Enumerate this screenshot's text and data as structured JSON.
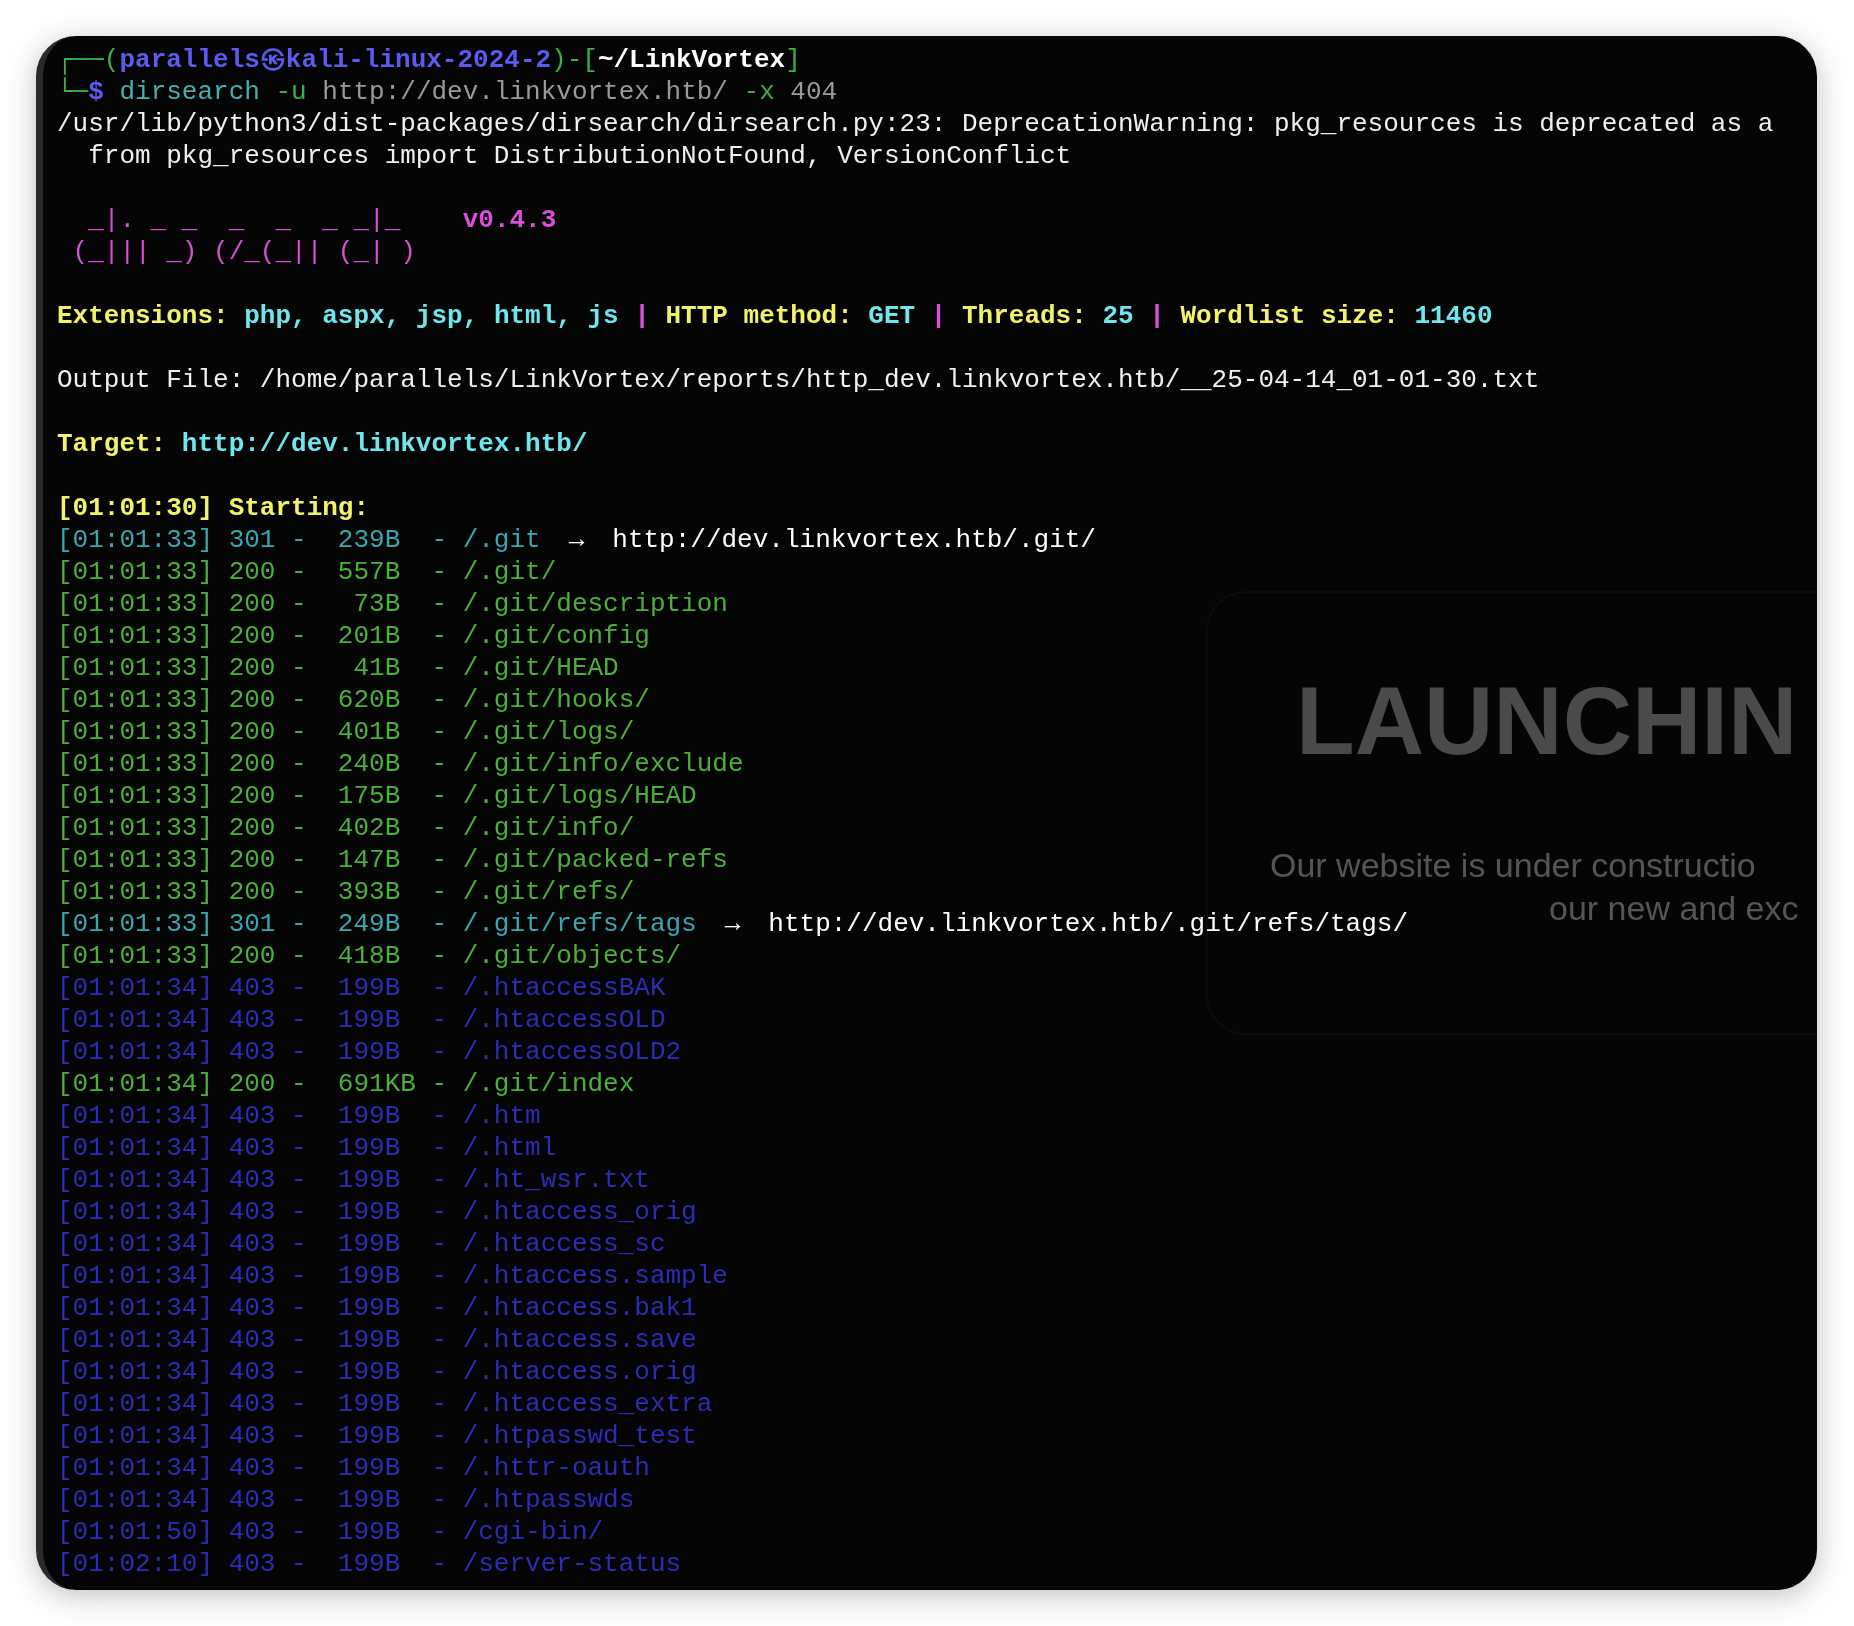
{
  "terminal": {
    "lines": [
      {
        "kind": "text",
        "segments": [
          {
            "text": "┌──(",
            "kind": "frame"
          },
          {
            "text": "parallels㉿kali-linux-2024-2",
            "kind": "userhost"
          },
          {
            "text": ")-[",
            "kind": "frame"
          },
          {
            "text": "~/LinkVortex",
            "kind": "cwd"
          },
          {
            "text": "]",
            "kind": "frame"
          }
        ]
      },
      {
        "kind": "text",
        "segments": [
          {
            "text": "└─",
            "kind": "frame"
          },
          {
            "text": "$",
            "kind": "dollar"
          },
          {
            "text": " dirsearch",
            "kind": "cmd"
          },
          {
            "text": " -u",
            "kind": "flag"
          },
          {
            "text": " http://dev.linkvortex.htb/",
            "kind": "arg"
          },
          {
            "text": " -x",
            "kind": "flag"
          },
          {
            "text": " 404",
            "kind": "arg"
          }
        ]
      },
      {
        "kind": "text",
        "segments": [
          {
            "text": "/usr/lib/python3/dist-packages/dirsearch/dirsearch.py:23: DeprecationWarning: pkg_resources is deprecated as a",
            "kind": "plain"
          }
        ]
      },
      {
        "kind": "text",
        "segments": [
          {
            "text": "  from pkg_resources import DistributionNotFound, VersionConflict",
            "kind": "plain"
          }
        ]
      },
      {
        "kind": "blank"
      },
      {
        "kind": "text",
        "segments": [
          {
            "text": "  _|. _ _  _  _  _ _|_",
            "kind": "banner"
          },
          {
            "text": "    v0.4.3",
            "kind": "version"
          }
        ]
      },
      {
        "kind": "text",
        "segments": [
          {
            "text": " (_||| _) (/_(_|| (_| )",
            "kind": "banner"
          }
        ]
      },
      {
        "kind": "blank"
      },
      {
        "kind": "text",
        "segments": [
          {
            "text": "Extensions: ",
            "kind": "label"
          },
          {
            "text": "php, aspx, jsp, html, js",
            "kind": "value"
          },
          {
            "text": " | ",
            "kind": "sep"
          },
          {
            "text": "HTTP method: ",
            "kind": "label"
          },
          {
            "text": "GET",
            "kind": "value"
          },
          {
            "text": " | ",
            "kind": "sep"
          },
          {
            "text": "Threads: ",
            "kind": "label"
          },
          {
            "text": "25",
            "kind": "value"
          },
          {
            "text": " | ",
            "kind": "sep"
          },
          {
            "text": "Wordlist size: ",
            "kind": "label"
          },
          {
            "text": "11460",
            "kind": "value"
          }
        ]
      },
      {
        "kind": "blank"
      },
      {
        "kind": "text",
        "segments": [
          {
            "text": "Output File: /home/parallels/LinkVortex/reports/http_dev.linkvortex.htb/__25-04-14_01-01-30.txt",
            "kind": "plain"
          }
        ]
      },
      {
        "kind": "blank"
      },
      {
        "kind": "text",
        "segments": [
          {
            "text": "Target: ",
            "kind": "label"
          },
          {
            "text": "http://dev.linkvortex.htb/",
            "kind": "value"
          }
        ]
      },
      {
        "kind": "blank"
      },
      {
        "kind": "text",
        "segments": [
          {
            "text": "[01:01:30] Starting:",
            "kind": "label"
          }
        ]
      },
      {
        "kind": "text",
        "segments": [
          {
            "text": "[01:01:33] 301 -  239B  - /.git",
            "kind": "redirect"
          },
          {
            "text": "→",
            "kind": "arrow"
          },
          {
            "text": "http://dev.linkvortex.htb/.git/",
            "kind": "url"
          }
        ]
      },
      {
        "kind": "text",
        "segments": [
          {
            "text": "[01:01:33] 200 -  557B  - /.git/",
            "kind": "ok"
          }
        ]
      },
      {
        "kind": "text",
        "segments": [
          {
            "text": "[01:01:33] 200 -   73B  - /.git/description",
            "kind": "ok"
          }
        ]
      },
      {
        "kind": "text",
        "segments": [
          {
            "text": "[01:01:33] 200 -  201B  - /.git/config",
            "kind": "ok"
          }
        ]
      },
      {
        "kind": "text",
        "segments": [
          {
            "text": "[01:01:33] 200 -   41B  - /.git/HEAD",
            "kind": "ok"
          }
        ]
      },
      {
        "kind": "text",
        "segments": [
          {
            "text": "[01:01:33] 200 -  620B  - /.git/hooks/",
            "kind": "ok"
          }
        ]
      },
      {
        "kind": "text",
        "segments": [
          {
            "text": "[01:01:33] 200 -  401B  - /.git/logs/",
            "kind": "ok"
          }
        ]
      },
      {
        "kind": "text",
        "segments": [
          {
            "text": "[01:01:33] 200 -  240B  - /.git/info/exclude",
            "kind": "ok"
          }
        ]
      },
      {
        "kind": "text",
        "segments": [
          {
            "text": "[01:01:33] 200 -  175B  - /.git/logs/HEAD",
            "kind": "ok"
          }
        ]
      },
      {
        "kind": "text",
        "segments": [
          {
            "text": "[01:01:33] 200 -  402B  - /.git/info/",
            "kind": "ok"
          }
        ]
      },
      {
        "kind": "text",
        "segments": [
          {
            "text": "[01:01:33] 200 -  147B  - /.git/packed-refs",
            "kind": "ok"
          }
        ]
      },
      {
        "kind": "text",
        "segments": [
          {
            "text": "[01:01:33] 200 -  393B  - /.git/refs/",
            "kind": "ok"
          }
        ]
      },
      {
        "kind": "text",
        "segments": [
          {
            "text": "[01:01:33] 301 -  249B  - /.git/refs/tags",
            "kind": "redirect"
          },
          {
            "text": "→",
            "kind": "arrow"
          },
          {
            "text": "http://dev.linkvortex.htb/.git/refs/tags/",
            "kind": "url"
          }
        ]
      },
      {
        "kind": "text",
        "segments": [
          {
            "text": "[01:01:33] 200 -  418B  - /.git/objects/",
            "kind": "ok"
          }
        ]
      },
      {
        "kind": "text",
        "segments": [
          {
            "text": "[01:01:34] 403 -  199B  - /.htaccessBAK",
            "kind": "forbidden"
          }
        ]
      },
      {
        "kind": "text",
        "segments": [
          {
            "text": "[01:01:34] 403 -  199B  - /.htaccessOLD",
            "kind": "forbidden"
          }
        ]
      },
      {
        "kind": "text",
        "segments": [
          {
            "text": "[01:01:34] 403 -  199B  - /.htaccessOLD2",
            "kind": "forbidden"
          }
        ]
      },
      {
        "kind": "text",
        "segments": [
          {
            "text": "[01:01:34] 200 -  691KB - /.git/index",
            "kind": "ok"
          }
        ]
      },
      {
        "kind": "text",
        "segments": [
          {
            "text": "[01:01:34] 403 -  199B  - /.htm",
            "kind": "forbidden"
          }
        ]
      },
      {
        "kind": "text",
        "segments": [
          {
            "text": "[01:01:34] 403 -  199B  - /.html",
            "kind": "forbidden"
          }
        ]
      },
      {
        "kind": "text",
        "segments": [
          {
            "text": "[01:01:34] 403 -  199B  - /.ht_wsr.txt",
            "kind": "forbidden"
          }
        ]
      },
      {
        "kind": "text",
        "segments": [
          {
            "text": "[01:01:34] 403 -  199B  - /.htaccess_orig",
            "kind": "forbidden"
          }
        ]
      },
      {
        "kind": "text",
        "segments": [
          {
            "text": "[01:01:34] 403 -  199B  - /.htaccess_sc",
            "kind": "forbidden"
          }
        ]
      },
      {
        "kind": "text",
        "segments": [
          {
            "text": "[01:01:34] 403 -  199B  - /.htaccess.sample",
            "kind": "forbidden"
          }
        ]
      },
      {
        "kind": "text",
        "segments": [
          {
            "text": "[01:01:34] 403 -  199B  - /.htaccess.bak1",
            "kind": "forbidden"
          }
        ]
      },
      {
        "kind": "text",
        "segments": [
          {
            "text": "[01:01:34] 403 -  199B  - /.htaccess.save",
            "kind": "forbidden"
          }
        ]
      },
      {
        "kind": "text",
        "segments": [
          {
            "text": "[01:01:34] 403 -  199B  - /.htaccess.orig",
            "kind": "forbidden"
          }
        ]
      },
      {
        "kind": "text",
        "segments": [
          {
            "text": "[01:01:34] 403 -  199B  - /.htaccess_extra",
            "kind": "forbidden"
          }
        ]
      },
      {
        "kind": "text",
        "segments": [
          {
            "text": "[01:01:34] 403 -  199B  - /.htpasswd_test",
            "kind": "forbidden"
          }
        ]
      },
      {
        "kind": "text",
        "segments": [
          {
            "text": "[01:01:34] 403 -  199B  - /.httr-oauth",
            "kind": "forbidden"
          }
        ]
      },
      {
        "kind": "text",
        "segments": [
          {
            "text": "[01:01:34] 403 -  199B  - /.htpasswds",
            "kind": "forbidden"
          }
        ]
      },
      {
        "kind": "text",
        "segments": [
          {
            "text": "[01:01:50] 403 -  199B  - /cgi-bin/",
            "kind": "forbidden"
          }
        ]
      },
      {
        "kind": "text",
        "segments": [
          {
            "text": "[01:02:10] 403 -  199B  - /server-status",
            "kind": "forbidden"
          }
        ]
      }
    ]
  },
  "background_window": {
    "title": "LAUNCHIN",
    "lines": [
      "Our website is under constructio",
      "our new and exc"
    ]
  }
}
